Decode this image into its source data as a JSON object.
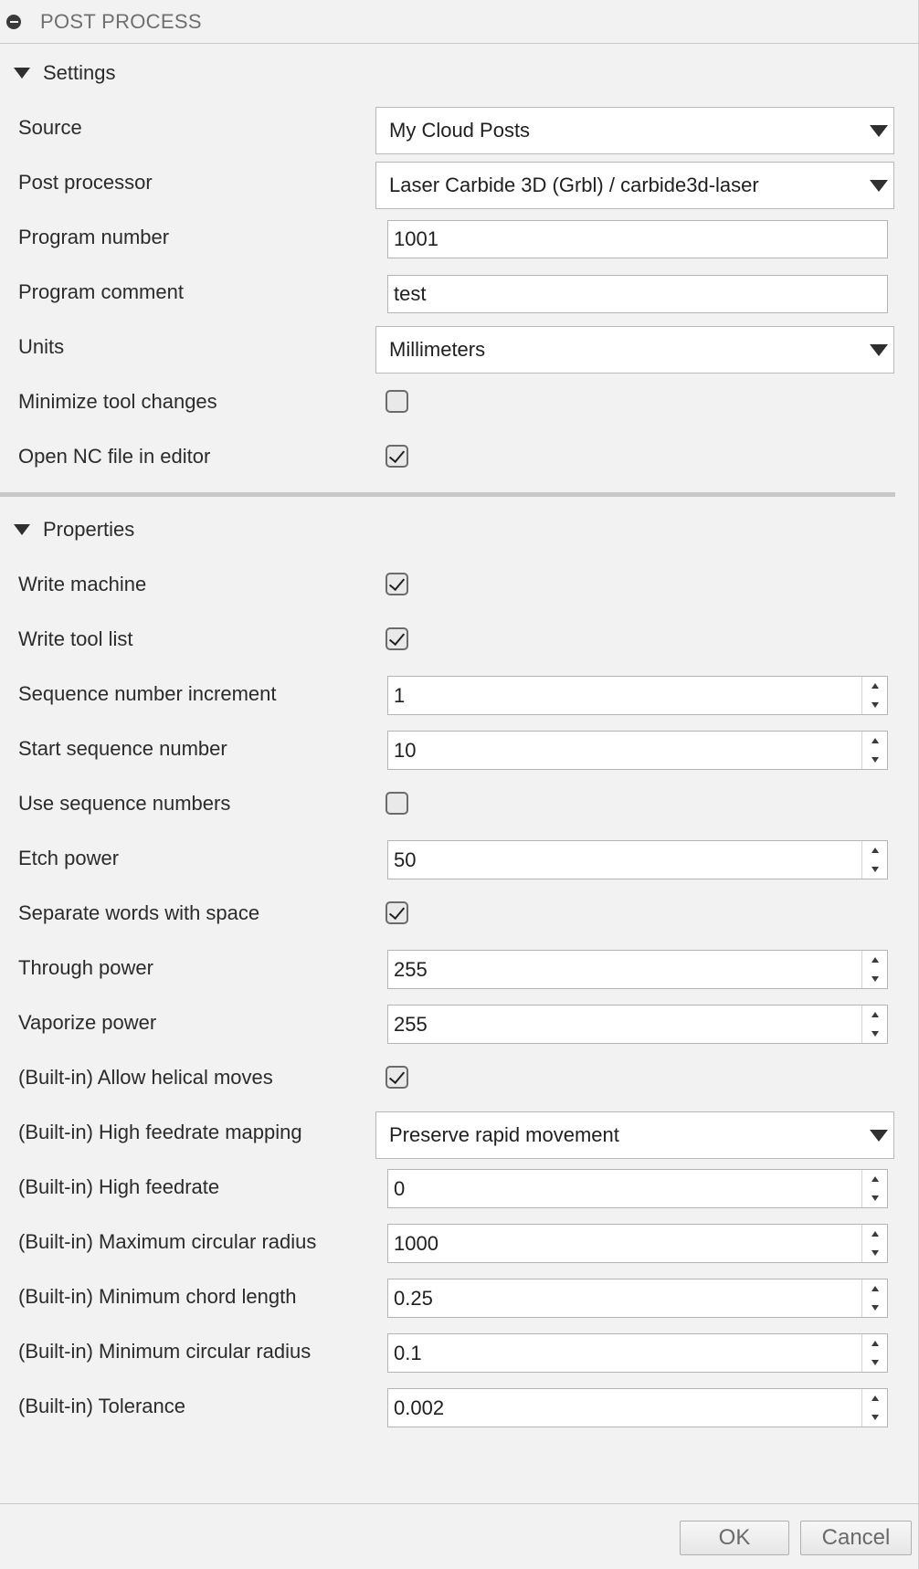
{
  "window": {
    "title": "POST PROCESS"
  },
  "settings": {
    "header": "Settings",
    "rows": [
      {
        "label": "Source",
        "type": "select",
        "value": "My Cloud Posts"
      },
      {
        "label": "Post processor",
        "type": "select",
        "value": "Laser Carbide 3D (Grbl) / carbide3d-laser"
      },
      {
        "label": "Program number",
        "type": "text",
        "value": "1001"
      },
      {
        "label": "Program comment",
        "type": "text",
        "value": "test"
      },
      {
        "label": "Units",
        "type": "select",
        "value": "Millimeters"
      },
      {
        "label": "Minimize tool changes",
        "type": "checkbox",
        "checked": false
      },
      {
        "label": "Open NC file in editor",
        "type": "checkbox",
        "checked": true
      }
    ]
  },
  "properties": {
    "header": "Properties",
    "rows": [
      {
        "label": "Write machine",
        "type": "checkbox",
        "checked": true
      },
      {
        "label": "Write tool list",
        "type": "checkbox",
        "checked": true
      },
      {
        "label": "Sequence number increment",
        "type": "spin",
        "value": "1"
      },
      {
        "label": "Start sequence number",
        "type": "spin",
        "value": "10"
      },
      {
        "label": "Use sequence numbers",
        "type": "checkbox",
        "checked": false
      },
      {
        "label": "Etch power",
        "type": "spin",
        "value": "50"
      },
      {
        "label": "Separate words with space",
        "type": "checkbox",
        "checked": true
      },
      {
        "label": "Through power",
        "type": "spin",
        "value": "255"
      },
      {
        "label": "Vaporize power",
        "type": "spin",
        "value": "255"
      },
      {
        "label": "(Built-in) Allow helical moves",
        "type": "checkbox",
        "checked": true
      },
      {
        "label": "(Built-in) High feedrate mapping",
        "type": "select",
        "value": "Preserve rapid movement"
      },
      {
        "label": "(Built-in) High feedrate",
        "type": "spin",
        "value": "0"
      },
      {
        "label": "(Built-in) Maximum circular radius",
        "type": "spin",
        "value": "1000"
      },
      {
        "label": "(Built-in) Minimum chord length",
        "type": "spin",
        "value": "0.25"
      },
      {
        "label": "(Built-in) Minimum circular radius",
        "type": "spin",
        "value": "0.1"
      },
      {
        "label": "(Built-in) Tolerance",
        "type": "spin",
        "value": "0.002"
      }
    ]
  },
  "footer": {
    "ok_label": "OK",
    "cancel_label": "Cancel"
  }
}
